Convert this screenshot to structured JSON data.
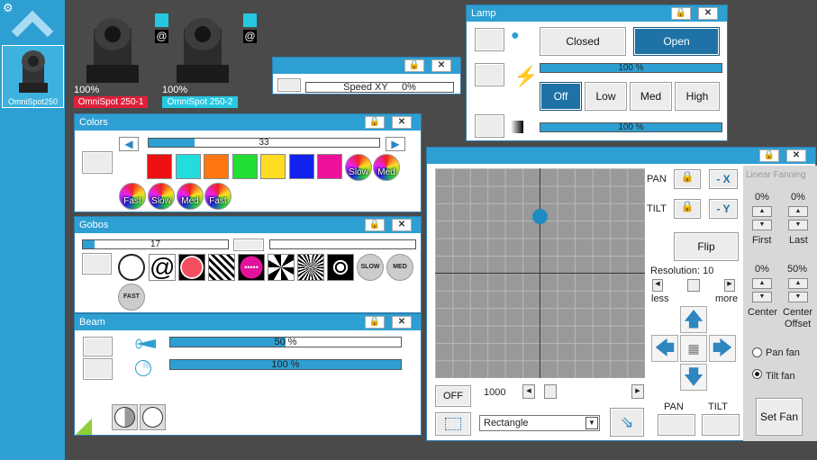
{
  "sidebar": {
    "settings_icon": "gear-icon",
    "fixture": {
      "name": "OmniSpot250"
    }
  },
  "fixtures": [
    {
      "percent": "100%",
      "name": "OmniSpot 250-1",
      "tag_color": "#e0203a"
    },
    {
      "percent": "100%",
      "name": "OmniSpot 250-2",
      "tag_color": "#26c8e0"
    }
  ],
  "speed": {
    "label": "Speed XY",
    "value": "0%"
  },
  "colors": {
    "title": "Colors",
    "value": "33",
    "value_fraction": 0.2,
    "swatches": [
      "#ee1111",
      "#22dddd",
      "#ff7711",
      "#22dd33",
      "#ffdd22",
      "#1122ee",
      "#ee1199"
    ],
    "effects": [
      "Slow",
      "Med",
      "Fast",
      "Slow",
      "Med",
      "Fast"
    ]
  },
  "gobos": {
    "title": "Gobos",
    "value": "17",
    "value_fraction": 0.08,
    "effects": [
      "SLOW",
      "MED",
      "FAST"
    ]
  },
  "beam": {
    "title": "Beam",
    "zoom": "50 %",
    "zoom_fraction": 0.5,
    "iris": "100 %",
    "iris_fraction": 1.0
  },
  "lamp": {
    "title": "Lamp",
    "closed": "Closed",
    "open": "Open",
    "power": "100 %",
    "power_fraction": 1.0,
    "off": "Off",
    "low": "Low",
    "med": "Med",
    "high": "High",
    "dimmer": "100 %",
    "dimmer_fraction": 1.0
  },
  "pantilt": {
    "pan": "PAN",
    "tilt": "TILT",
    "pan_invert": "- X",
    "tilt_invert": "- Y",
    "flip": "Flip",
    "resolution": "Resolution: 10",
    "less": "less",
    "more": "more",
    "off": "OFF",
    "speed": "1000",
    "shape": "Rectangle",
    "pan_btn": "PAN",
    "tilt_btn": "TILT",
    "linear_fanning": "Linear Fanning",
    "first_pct": "0%",
    "last_pct": "0%",
    "first": "First",
    "last": "Last",
    "center_pct": "0%",
    "offset_pct": "50%",
    "center": "Center",
    "center_offset_1": "Center",
    "center_offset_2": "Offset",
    "pan_fan": "Pan fan",
    "tilt_fan": "Tilt fan",
    "set_fan": "Set Fan"
  }
}
